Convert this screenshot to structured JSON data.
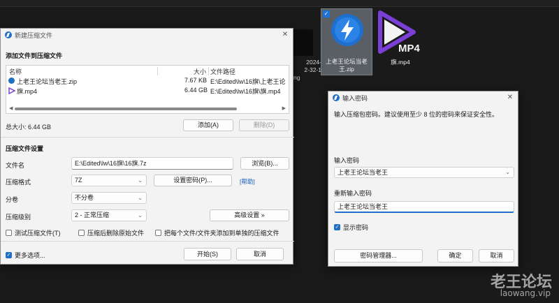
{
  "desktop": {
    "partial_label_lines": [
      "2024-",
      "2-32-1",
      "ng"
    ],
    "selected_item": {
      "label_line1": "上老王论坛当老",
      "label_line2": "王.zip",
      "checked_mark": "✓"
    },
    "mp4_item": {
      "badge": "MP4",
      "label": "旗.mp4"
    }
  },
  "archive_window": {
    "title": "新建压缩文件",
    "add_section_title": "添加文件到压缩文件",
    "columns": {
      "name": "名称",
      "size": "大小",
      "path": "文件路径"
    },
    "files": [
      {
        "name": "上老王论坛当老王.zip",
        "size": "7.67 KB",
        "path": "E:\\Edited\\lw\\16旗\\上老王论"
      },
      {
        "name": "旗.mp4",
        "size": "6.44 GB",
        "path": "E:\\Edited\\lw\\16旗\\旗.mp4"
      }
    ],
    "total_size_label": "总大小: 6.44 GB",
    "add_button": "添加(A)",
    "remove_button": "删除(D)",
    "settings_title": "压缩文件设置",
    "filename_label": "文件名",
    "filename_value": "E:\\Edited\\lw\\16旗\\16旗.7z",
    "browse_button": "浏览(B)...",
    "format_label": "压缩格式",
    "format_value": "7Z",
    "set_password_button": "设置密码(P)...",
    "help_link": "[帮助]",
    "split_label": "分卷",
    "split_value": "不分卷",
    "level_label": "压缩级别",
    "level_value": "2 - 正常压缩",
    "advanced_button": "高级设置 »",
    "opt_test": "测试压缩文件(T)",
    "opt_delete": "压缩后删除原始文件",
    "opt_each": "把每个文件/文件夹添加到单独的压缩文件",
    "more_options": "更多选项...",
    "start_button": "开始(S)",
    "cancel_button": "取消"
  },
  "password_window": {
    "title": "输入密码",
    "description": "输入压缩包密码。建议使用至少 8 位的密码来保证安全性。",
    "enter_label": "输入密码",
    "enter_value": "上老王论坛当老王",
    "reenter_label": "重新输入密码",
    "reenter_value": "上老王论坛当老王",
    "show_password": "显示密码",
    "manager_button": "密码管理器...",
    "ok_button": "确定",
    "cancel_button": "取消"
  },
  "watermark": {
    "line1": "老王论坛",
    "line2": "laowang.vip"
  },
  "colors": {
    "accent": "#1f6fc4",
    "desktop_bg": "#1a1a1a",
    "mp4_purple": "#7b3fd6"
  }
}
